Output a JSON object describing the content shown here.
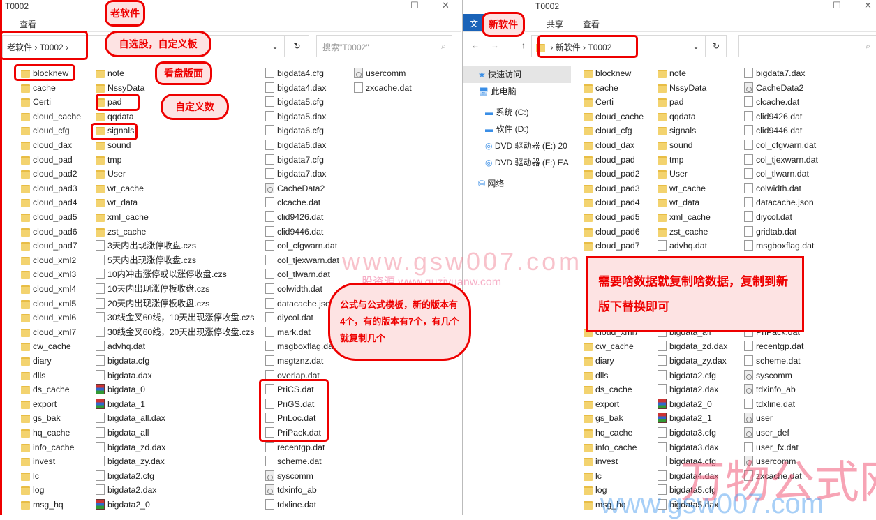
{
  "left": {
    "title": "T0002",
    "ribbon": [
      "查看"
    ],
    "breadcrumb": [
      "老软件",
      "T0002"
    ],
    "search_placeholder": "搜索\"T0002\"",
    "columns": [
      [
        [
          "folder",
          "blocknew"
        ],
        [
          "folder",
          "cache"
        ],
        [
          "folder",
          "Certi"
        ],
        [
          "folder",
          "cloud_cache"
        ],
        [
          "folder",
          "cloud_cfg"
        ],
        [
          "folder",
          "cloud_dax"
        ],
        [
          "folder",
          "cloud_pad"
        ],
        [
          "folder",
          "cloud_pad2"
        ],
        [
          "folder",
          "cloud_pad3"
        ],
        [
          "folder",
          "cloud_pad4"
        ],
        [
          "folder",
          "cloud_pad5"
        ],
        [
          "folder",
          "cloud_pad6"
        ],
        [
          "folder",
          "cloud_pad7"
        ],
        [
          "folder",
          "cloud_xml2"
        ],
        [
          "folder",
          "cloud_xml3"
        ],
        [
          "folder",
          "cloud_xml4"
        ],
        [
          "folder",
          "cloud_xml5"
        ],
        [
          "folder",
          "cloud_xml6"
        ],
        [
          "folder",
          "cloud_xml7"
        ],
        [
          "folder",
          "cw_cache"
        ],
        [
          "folder",
          "diary"
        ],
        [
          "folder",
          "dlls"
        ],
        [
          "folder",
          "ds_cache"
        ],
        [
          "folder",
          "export"
        ],
        [
          "folder",
          "gs_bak"
        ],
        [
          "folder",
          "hq_cache"
        ],
        [
          "folder",
          "info_cache"
        ],
        [
          "folder",
          "invest"
        ],
        [
          "folder",
          "lc"
        ],
        [
          "folder",
          "log"
        ],
        [
          "folder",
          "msg_hq"
        ]
      ],
      [
        [
          "folder",
          "note"
        ],
        [
          "folder",
          "NssyData"
        ],
        [
          "folder",
          "pad"
        ],
        [
          "folder",
          "qqdata"
        ],
        [
          "folder",
          "signals"
        ],
        [
          "folder",
          "sound"
        ],
        [
          "folder",
          "tmp"
        ],
        [
          "folder",
          "User"
        ],
        [
          "folder",
          "wt_cache"
        ],
        [
          "folder",
          "wt_data"
        ],
        [
          "folder",
          "xml_cache"
        ],
        [
          "folder",
          "zst_cache"
        ],
        [
          "file",
          "3天内出现涨停收盘.czs"
        ],
        [
          "file",
          "5天内出现涨停收盘.czs"
        ],
        [
          "file",
          "10内冲击涨停或以涨停收盘.czs"
        ],
        [
          "file",
          "10天内出现涨停板收盘.czs"
        ],
        [
          "file",
          "20天内出现涨停板收盘.czs"
        ],
        [
          "file",
          "30线金叉60线，10天出现涨停收盘.czs"
        ],
        [
          "file",
          "30线金叉60线，20天出现涨停收盘.czs"
        ],
        [
          "file",
          "advhq.dat"
        ],
        [
          "file",
          "bigdata.cfg"
        ],
        [
          "file",
          "bigdata.dax"
        ],
        [
          "rar",
          "bigdata_0"
        ],
        [
          "rar",
          "bigdata_1"
        ],
        [
          "file",
          "bigdata_all.dax"
        ],
        [
          "file",
          "bigdata_all"
        ],
        [
          "file",
          "bigdata_zd.dax"
        ],
        [
          "file",
          "bigdata_zy.dax"
        ],
        [
          "file",
          "bigdata2.cfg"
        ],
        [
          "file",
          "bigdata2.dax"
        ],
        [
          "rar",
          "bigdata2_0"
        ]
      ],
      [
        [
          "file",
          "bigdata4.cfg"
        ],
        [
          "file",
          "bigdata4.dax"
        ],
        [
          "file",
          "bigdata5.cfg"
        ],
        [
          "file",
          "bigdata5.dax"
        ],
        [
          "file",
          "bigdata6.cfg"
        ],
        [
          "file",
          "bigdata6.dax"
        ],
        [
          "file",
          "bigdata7.cfg"
        ],
        [
          "file",
          "bigdata7.dax"
        ],
        [
          "sys",
          "CacheData2"
        ],
        [
          "file",
          "clcache.dat"
        ],
        [
          "file",
          "clid9426.dat"
        ],
        [
          "file",
          "clid9446.dat"
        ],
        [
          "file",
          "col_cfgwarn.dat"
        ],
        [
          "file",
          "col_tjexwarn.dat"
        ],
        [
          "file",
          "col_tlwarn.dat"
        ],
        [
          "file",
          "colwidth.dat"
        ],
        [
          "file",
          "datacache.json"
        ],
        [
          "file",
          "diycol.dat"
        ],
        [
          "file",
          "mark.dat"
        ],
        [
          "file",
          "msgboxflag.dat"
        ],
        [
          "file",
          "msgtznz.dat"
        ],
        [
          "file",
          "overlap.dat"
        ],
        [
          "file",
          "PriCS.dat"
        ],
        [
          "file",
          "PriGS.dat"
        ],
        [
          "file",
          "PriLoc.dat"
        ],
        [
          "file",
          "PriPack.dat"
        ],
        [
          "file",
          "recentgp.dat"
        ],
        [
          "file",
          "scheme.dat"
        ],
        [
          "sys",
          "syscomm"
        ],
        [
          "sys",
          "tdxinfo_ab"
        ],
        [
          "file",
          "tdxline.dat"
        ]
      ],
      [
        [
          "sys",
          "usercomm"
        ],
        [
          "file",
          "zxcache.dat"
        ]
      ]
    ]
  },
  "right": {
    "title": "T0002",
    "ribbon": [
      "文",
      "共享",
      "查看"
    ],
    "breadcrumb": [
      "新软件",
      "T0002"
    ],
    "nav": [
      {
        "icon": "star-icon",
        "label": "快速访问"
      },
      {
        "icon": "computer-icon",
        "label": "此电脑"
      },
      {
        "icon": "drive-icon",
        "label": "系统 (C:)"
      },
      {
        "icon": "drive-icon",
        "label": "软件 (D:)"
      },
      {
        "icon": "dvd-icon",
        "label": "DVD 驱动器 (E:) 20"
      },
      {
        "icon": "dvd-icon",
        "label": "DVD 驱动器 (F:) EA"
      },
      {
        "icon": "network-icon",
        "label": "网络"
      }
    ],
    "columns": [
      [
        [
          "folder",
          "blocknew"
        ],
        [
          "folder",
          "cache"
        ],
        [
          "folder",
          "Certi"
        ],
        [
          "folder",
          "cloud_cache"
        ],
        [
          "folder",
          "cloud_cfg"
        ],
        [
          "folder",
          "cloud_dax"
        ],
        [
          "folder",
          "cloud_pad"
        ],
        [
          "folder",
          "cloud_pad2"
        ],
        [
          "folder",
          "cloud_pad3"
        ],
        [
          "folder",
          "cloud_pad4"
        ],
        [
          "folder",
          "cloud_pad5"
        ],
        [
          "folder",
          "cloud_pad6"
        ],
        [
          "folder",
          "cloud_pad7"
        ],
        [
          "",
          ""
        ],
        [
          "",
          ""
        ],
        [
          "",
          ""
        ],
        [
          "",
          ""
        ],
        [
          "",
          ""
        ],
        [
          "folder",
          "cloud_xml7"
        ],
        [
          "folder",
          "cw_cache"
        ],
        [
          "folder",
          "diary"
        ],
        [
          "folder",
          "dlls"
        ],
        [
          "folder",
          "ds_cache"
        ],
        [
          "folder",
          "export"
        ],
        [
          "folder",
          "gs_bak"
        ],
        [
          "folder",
          "hq_cache"
        ],
        [
          "folder",
          "info_cache"
        ],
        [
          "folder",
          "invest"
        ],
        [
          "folder",
          "lc"
        ],
        [
          "folder",
          "log"
        ],
        [
          "folder",
          "msg_hq"
        ]
      ],
      [
        [
          "folder",
          "note"
        ],
        [
          "folder",
          "NssyData"
        ],
        [
          "folder",
          "pad"
        ],
        [
          "folder",
          "qqdata"
        ],
        [
          "folder",
          "signals"
        ],
        [
          "folder",
          "sound"
        ],
        [
          "folder",
          "tmp"
        ],
        [
          "folder",
          "User"
        ],
        [
          "folder",
          "wt_cache"
        ],
        [
          "folder",
          "wt_data"
        ],
        [
          "folder",
          "xml_cache"
        ],
        [
          "folder",
          "zst_cache"
        ],
        [
          "file",
          "advhq.dat"
        ],
        [
          "",
          ""
        ],
        [
          "",
          ""
        ],
        [
          "",
          ""
        ],
        [
          "",
          ""
        ],
        [
          "",
          ""
        ],
        [
          "file",
          "bigdata_all"
        ],
        [
          "file",
          "bigdata_zd.dax"
        ],
        [
          "file",
          "bigdata_zy.dax"
        ],
        [
          "file",
          "bigdata2.cfg"
        ],
        [
          "file",
          "bigdata2.dax"
        ],
        [
          "rar",
          "bigdata2_0"
        ],
        [
          "rar",
          "bigdata2_1"
        ],
        [
          "file",
          "bigdata3.cfg"
        ],
        [
          "file",
          "bigdata3.dax"
        ],
        [
          "file",
          "bigdata4.cfg"
        ],
        [
          "file",
          "bigdata4.dax"
        ],
        [
          "file",
          "bigdata5.cfg"
        ],
        [
          "file",
          "bigdata5.dax"
        ]
      ],
      [
        [
          "file",
          "bigdata7.dax"
        ],
        [
          "sys",
          "CacheData2"
        ],
        [
          "file",
          "clcache.dat"
        ],
        [
          "file",
          "clid9426.dat"
        ],
        [
          "file",
          "clid9446.dat"
        ],
        [
          "file",
          "col_cfgwarn.dat"
        ],
        [
          "file",
          "col_tjexwarn.dat"
        ],
        [
          "file",
          "col_tlwarn.dat"
        ],
        [
          "file",
          "colwidth.dat"
        ],
        [
          "file",
          "datacache.json"
        ],
        [
          "file",
          "diycol.dat"
        ],
        [
          "file",
          "gridtab.dat"
        ],
        [
          "file",
          "msgboxflag.dat"
        ],
        [
          "",
          ""
        ],
        [
          "",
          ""
        ],
        [
          "",
          ""
        ],
        [
          "",
          ""
        ],
        [
          "",
          ""
        ],
        [
          "file",
          "PriPack.dat"
        ],
        [
          "file",
          "recentgp.dat"
        ],
        [
          "file",
          "scheme.dat"
        ],
        [
          "sys",
          "syscomm"
        ],
        [
          "sys",
          "tdxinfo_ab"
        ],
        [
          "file",
          "tdxline.dat"
        ],
        [
          "sys",
          "user"
        ],
        [
          "sys",
          "user_def"
        ],
        [
          "file",
          "user_fx.dat"
        ],
        [
          "sys",
          "usercomm"
        ],
        [
          "file",
          "zxcache.dat"
        ]
      ]
    ]
  },
  "annotations": {
    "old_software": "老软件",
    "custom_stocks": "自选股，自定义板",
    "layout": "看盘版面",
    "custom_indicators": "自定义数",
    "new_software": "新软件",
    "formulas": "公式与公式模板，新的版本有4个，有的版本有7个，有几个就复制几个",
    "instruction": "需要啥数据就复制啥数据，复制到新版下替换即可"
  },
  "watermarks": {
    "site1": "www.gsw007.com",
    "site2": "股资源 www.guziyuanw.com",
    "brand": "万物公式网",
    "site3": "www.gsw007.com"
  },
  "colors": {
    "annotation": "#e00000",
    "folder": "#f3d36f"
  }
}
